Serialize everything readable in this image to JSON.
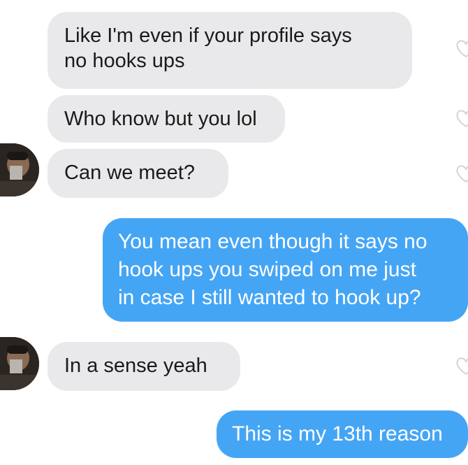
{
  "messages": [
    {
      "id": "m1",
      "direction": "received",
      "text": "Like I'm even if your profile says\nno hooks ups",
      "liked": false
    },
    {
      "id": "m2",
      "direction": "received",
      "text": "Who know but you lol",
      "liked": false
    },
    {
      "id": "m3",
      "direction": "received",
      "text": "Can we meet?",
      "liked": false
    },
    {
      "id": "m4",
      "direction": "sent",
      "text": "You mean even though it says no\nhook ups you swiped on me just\nin case I still wanted to hook up?"
    },
    {
      "id": "m5",
      "direction": "received",
      "text": "In a sense yeah",
      "liked": false
    },
    {
      "id": "m6",
      "direction": "sent",
      "text": "This is my 13th reason"
    }
  ],
  "icons": {
    "like": "heart-outline-icon",
    "avatar": "sender-avatar"
  },
  "colors": {
    "received_bubble": "#e9e9eb",
    "sent_bubble": "#45a5f5",
    "received_text": "#1a1a1a",
    "sent_text": "#ffffff",
    "heart_outline": "#d4d4d4"
  }
}
